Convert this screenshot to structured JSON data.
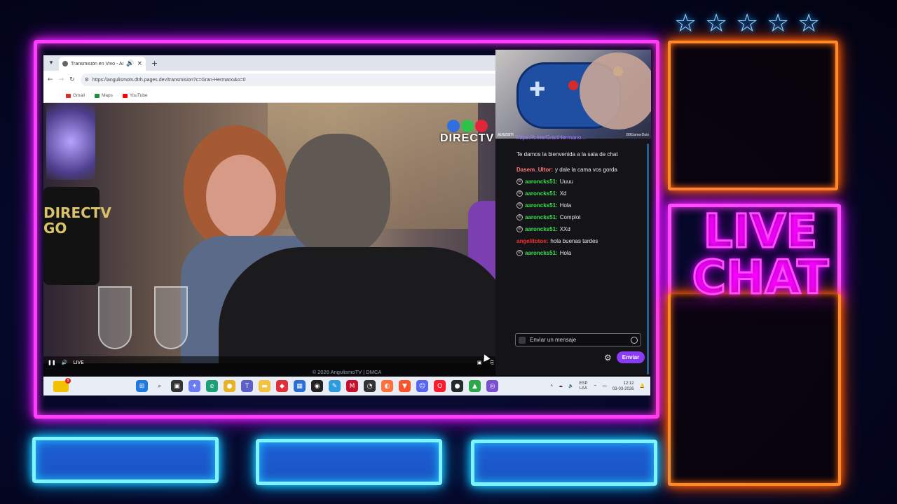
{
  "browser": {
    "tab_title": "Transmisión en Vivo - Ang...",
    "url": "https://angulismotv.dtrh.pages.dev/transmision?c=Gran-Hermano&o=0",
    "bookmarks": [
      {
        "label": "Gmail",
        "color": "#d93025"
      },
      {
        "label": "Maps",
        "color": "#1e8e3e"
      },
      {
        "label": "YouTube",
        "color": "#ff0000"
      }
    ]
  },
  "video": {
    "logo_text": "DIRECTV",
    "live_label": "LIVE",
    "bag_text": "DIRECTV\nGO",
    "footer": "© 2026 AngulismoTV | DMCA"
  },
  "webcam": {
    "tag_left": "AUGOSTI",
    "tag_right": "BBGamerDots"
  },
  "chat": {
    "link": "https://t.me/GranHermano...",
    "welcome": "Te damos la bienvenida a la sala de chat",
    "messages": [
      {
        "user": "Dasem_Ultor",
        "text": "y dale la cama vos gorda",
        "color": "#ff7a7a",
        "mod": false
      },
      {
        "user": "aaroncks51",
        "text": "Uuuu",
        "color": "#39e04c",
        "mod": true
      },
      {
        "user": "aaroncks51",
        "text": "Xd",
        "color": "#39e04c",
        "mod": true
      },
      {
        "user": "aaroncks51",
        "text": "Hola",
        "color": "#39e04c",
        "mod": true
      },
      {
        "user": "aaroncks51",
        "text": "Complot",
        "color": "#39e04c",
        "mod": true
      },
      {
        "user": "aaroncks51",
        "text": "XXd",
        "color": "#39e04c",
        "mod": true
      },
      {
        "user": "angelitotoe",
        "text": "hola buenas tardes",
        "color": "#ff2b2b",
        "mod": false
      },
      {
        "user": "aaroncks51",
        "text": "Hola",
        "color": "#39e04c",
        "mod": true
      }
    ],
    "input_placeholder": "Enviar un mensaje",
    "send_label": "Enviar"
  },
  "overlay": {
    "live_chat_text": "LIVE\nCHAT",
    "star_count": 5
  },
  "taskbar": {
    "badge": "8",
    "lang_line1": "ESP",
    "lang_line2": "LAA",
    "time": "12:12",
    "date": "03-03-2026"
  },
  "colors": {
    "neon_pink": "#ff3dff",
    "neon_orange": "#ff8a2a",
    "neon_cyan": "#7ff3ff",
    "send_button": "#8a3cf5"
  }
}
